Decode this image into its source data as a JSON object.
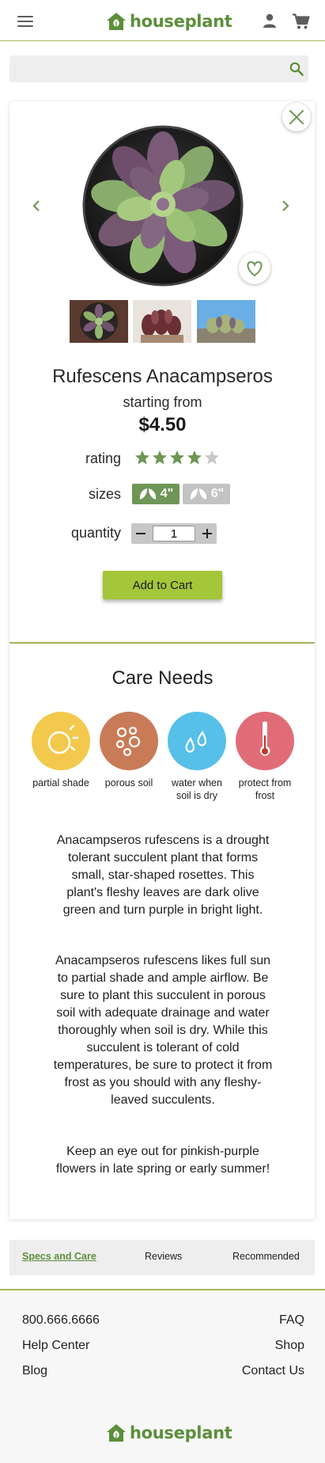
{
  "header": {
    "logo_text": "houseplant",
    "menu_icon": "hamburger-menu-icon",
    "user_icon": "user-icon",
    "cart_icon": "shopping-cart-icon"
  },
  "search": {
    "placeholder": "",
    "icon": "search-icon"
  },
  "product": {
    "name": "Rufescens Anacampseros",
    "starting_label": "starting from",
    "price": "$4.50",
    "rating_label": "rating",
    "rating_value": 4,
    "rating_max": 5,
    "sizes_label": "sizes",
    "sizes": [
      {
        "label": "4\"",
        "selected": true
      },
      {
        "label": "6\"",
        "selected": false
      }
    ],
    "quantity_label": "quantity",
    "quantity": "1",
    "add_to_cart": "Add to Cart"
  },
  "care": {
    "title": "Care Needs",
    "items": [
      {
        "label": "partial shade",
        "icon": "sun-icon",
        "color": "#f2c94c"
      },
      {
        "label": "porous soil",
        "icon": "soil-icon",
        "color": "#c97b58"
      },
      {
        "label": "water when soil is dry",
        "icon": "water-drops-icon",
        "color": "#56c0e8"
      },
      {
        "label": "protect from frost",
        "icon": "thermometer-icon",
        "color": "#e06c78"
      }
    ]
  },
  "description": [
    "Anacampseros rufescens is a drought tolerant succulent plant that forms small, star-shaped rosettes. This plant's fleshy leaves are dark olive green and turn purple in bright light.",
    "Anacampseros rufescens likes full sun to partial shade and ample airflow. Be sure to plant this succulent in porous soil with adequate drainage and water thoroughly when soil is dry. While this succulent is tolerant of cold temperatures, be sure to protect it from frost as you should with any fleshy-leaved succulents.",
    "Keep an eye out for pinkish-purple flowers in late spring or early summer!"
  ],
  "tabs": {
    "specs": "Specs and Care",
    "reviews": "Reviews",
    "recommended": "Recommended"
  },
  "footer": {
    "phone": "800.666.6666",
    "help": "Help Center",
    "blog": "Blog",
    "faq": "FAQ",
    "shop": "Shop",
    "contact": "Contact Us",
    "logo_text": "houseplant"
  },
  "colors": {
    "brand_green": "#5b8f3a",
    "accent_lime": "#a4c639",
    "divider": "#a4b55a"
  }
}
